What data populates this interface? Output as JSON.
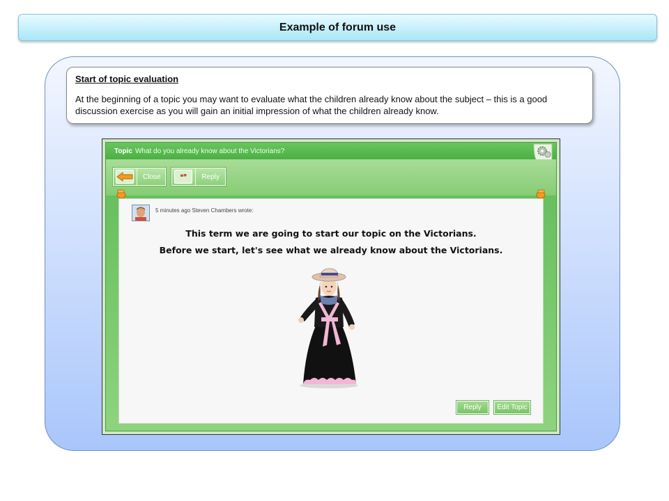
{
  "slide": {
    "title": "Example of forum use",
    "section_heading": "Start of topic evaluation",
    "section_text": "At the beginning of a topic you may want to evaluate what the children already know about the subject – this is a good discussion exercise as you will gain an initial impression of what the children already know."
  },
  "forum": {
    "topic_label": "Topic",
    "topic_title": "What do you already know about the Victorians?",
    "toolbar": {
      "close_label": "Close",
      "reply_label": "Reply",
      "quote_glyph": "❝❞"
    },
    "post": {
      "meta": "5 minutes ago Steven Chambers wrote:",
      "line1": "This term we are going to start our topic on the Victorians.",
      "line2": "Before we start, let's see what we already know about the Victorians."
    },
    "actions": {
      "reply_label": "Reply",
      "edit_topic_label": "Edit Topic"
    },
    "colors": {
      "green_dark": "#4caf44",
      "green_light": "#8fd37f",
      "panel_blue": "#a9c6fb"
    }
  }
}
